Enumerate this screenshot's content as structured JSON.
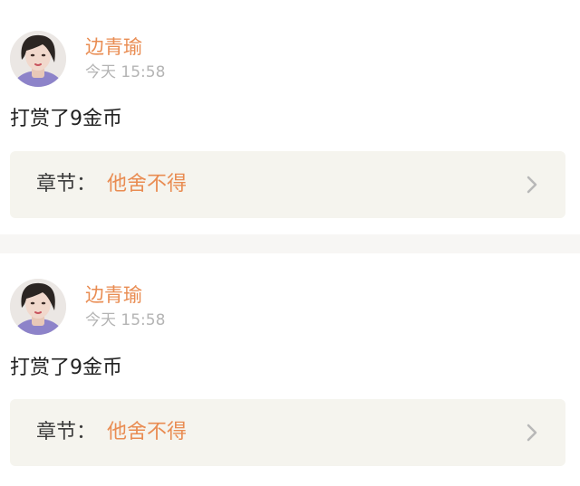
{
  "feed": {
    "items": [
      {
        "user_name": "边青瑜",
        "time": "今天 15:58",
        "message": "打赏了9金币",
        "chapter_prefix": "章节：",
        "chapter_name": "他舍不得"
      },
      {
        "user_name": "边青瑜",
        "time": "今天 15:58",
        "message": "打赏了9金币",
        "chapter_prefix": "章节：",
        "chapter_name": "他舍不得"
      }
    ]
  },
  "colors": {
    "accent": "#e98c52",
    "timestamp": "#b4b4b4",
    "chapter_background": "#f5f4ee",
    "separator": "#f7f6f4"
  },
  "icons": {
    "avatar": "user-avatar-icon",
    "chevron": "chevron-right-icon"
  }
}
